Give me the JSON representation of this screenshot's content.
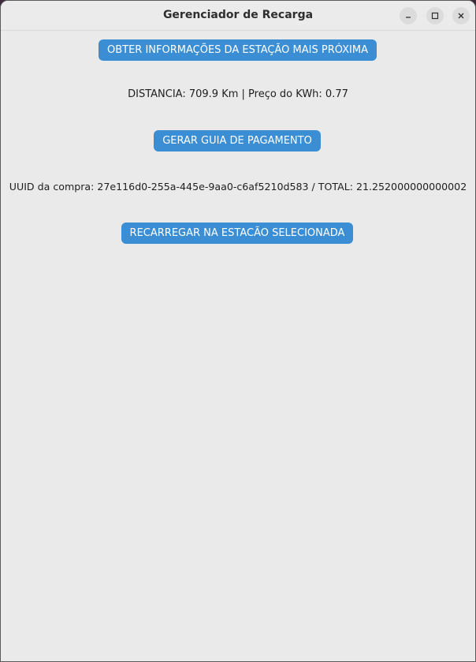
{
  "window": {
    "title": "Gerenciador de Recarga",
    "controls": {
      "minimize_icon": "minimize-icon",
      "maximize_icon": "maximize-icon",
      "close_icon": "close-icon"
    }
  },
  "actions": {
    "get_station_label": "OBTER INFORMAÇÕES DA ESTAÇÃO MAIS PRÓXIMA",
    "generate_payment_label": "GERAR GUIA DE PAGAMENTO",
    "recharge_label": "RECARREGAR NA ESTACÃO SELECIONADA"
  },
  "info": {
    "distance_price": "DISTANCIA: 709.9 Km | Preço do KWh: 0.77",
    "purchase": "UUID da compra: 27e116d0-255a-445e-9aa0-c6af5210d583 / TOTAL: 21.252000000000002"
  },
  "colors": {
    "button_bg": "#3b8ed3",
    "window_bg": "#eaeaea"
  }
}
